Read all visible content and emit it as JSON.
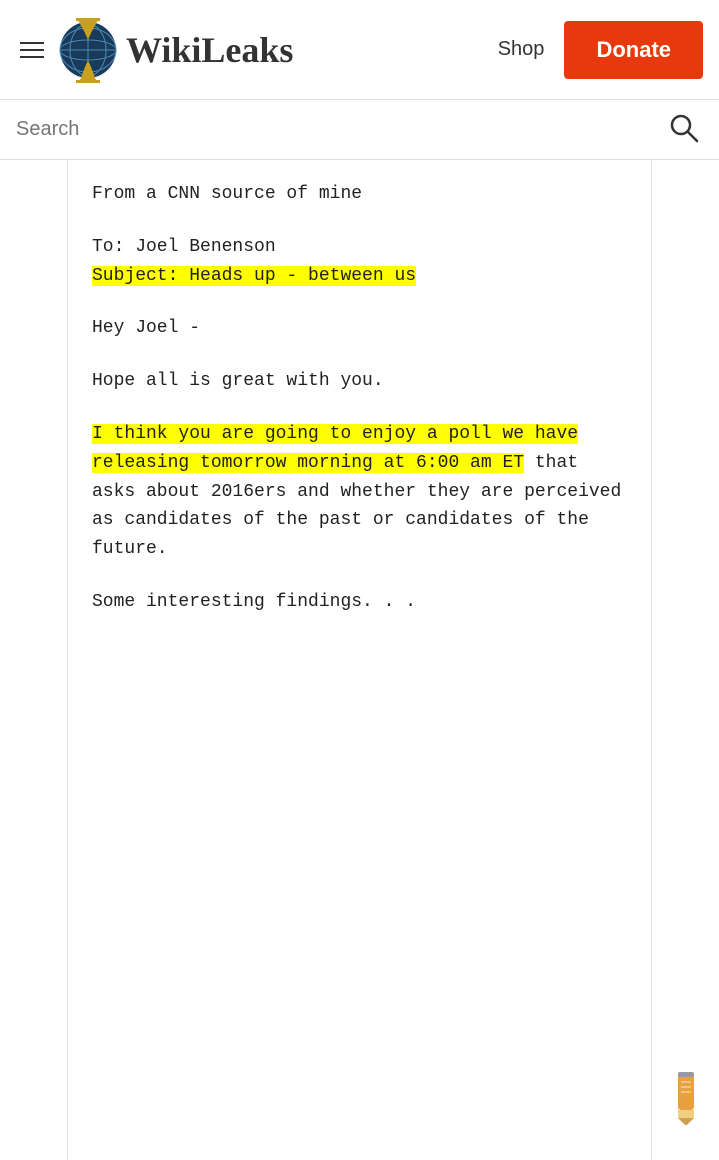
{
  "header": {
    "menu_label": "Menu",
    "logo_text": "WikiLeaks",
    "shop_label": "Shop",
    "donate_label": "Donate"
  },
  "search": {
    "placeholder": "Search"
  },
  "email": {
    "line1": "From a CNN source of mine",
    "line2": "To: Joel Benenson",
    "line3_highlight": "Subject: Heads up - between us",
    "line4": "Hey Joel -",
    "line5": "Hope all is great with you.",
    "line6_highlight": "I think you are going to enjoy a poll we have releasing tomorrow morning at 6:00 am ET",
    "line6_rest": " that asks about 2016ers and whether they are perceived as candidates of the past or candidates of the future.",
    "line7": "Some interesting findings. . ."
  },
  "colors": {
    "donate_bg": "#e8380d",
    "highlight_yellow": "#ffff00",
    "logo_text_color": "#333"
  }
}
